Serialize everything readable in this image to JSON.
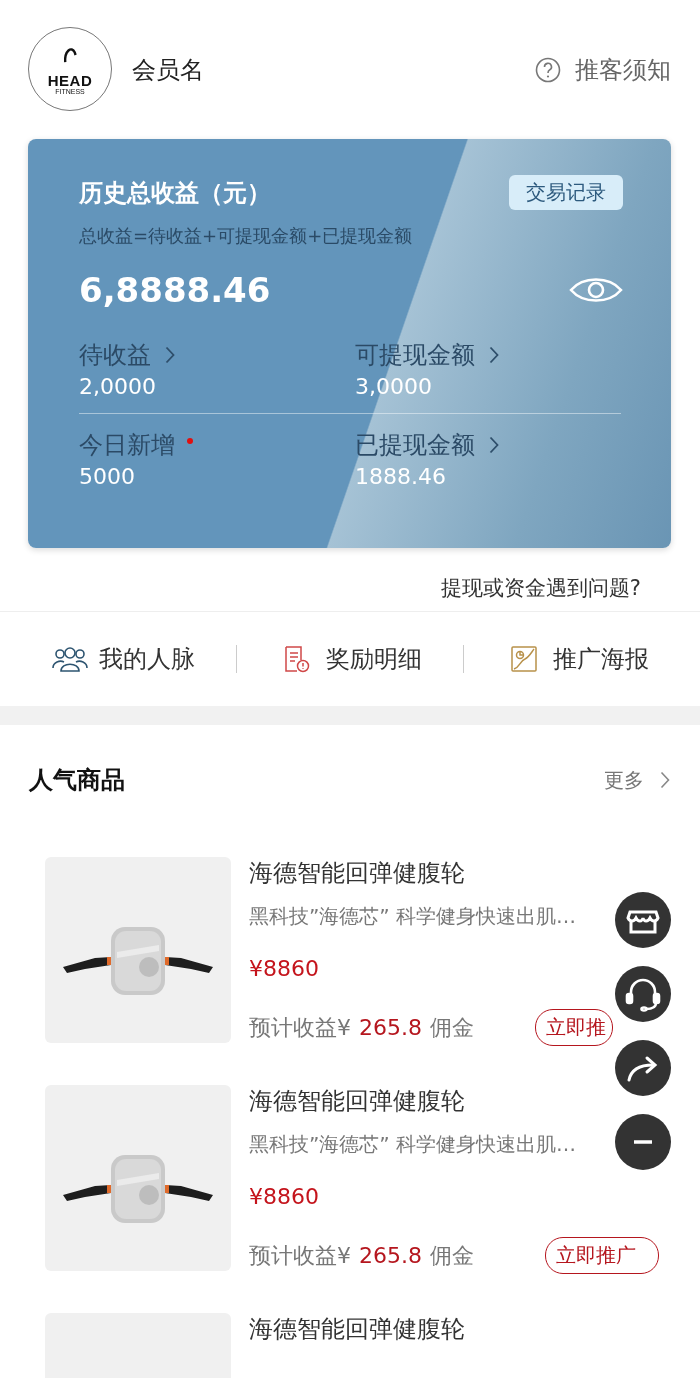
{
  "header": {
    "logo_text": "HEAD",
    "logo_subtext": "FITNESS",
    "member_name": "会员名",
    "guide": "推客须知"
  },
  "earnings_card": {
    "title": "历史总收益（元）",
    "records_button": "交易记录",
    "formula": "总收益=待收益+可提现金额+已提现金额",
    "total": "6,8888.46",
    "stats": [
      {
        "label": "待收益",
        "value": "2,0000",
        "arrow": true,
        "dot": false
      },
      {
        "label": "可提现金额",
        "value": "3,0000",
        "arrow": true,
        "dot": false
      },
      {
        "label": "今日新增",
        "value": "5000",
        "arrow": false,
        "dot": true
      },
      {
        "label": "已提现金额",
        "value": "1888.46",
        "arrow": true,
        "dot": false
      }
    ]
  },
  "help_link": "提现或资金遇到问题?",
  "shortcuts": [
    {
      "label": "我的人脉",
      "kind": "people"
    },
    {
      "label": "奖励明细",
      "kind": "report"
    },
    {
      "label": "推广海报",
      "kind": "poster"
    }
  ],
  "section": {
    "title": "人气商品",
    "more": "更多"
  },
  "products": [
    {
      "title": "海德智能回弹健腹轮",
      "description": "黑科技”海德芯” 科学健身快速出肌…",
      "price": "¥8860",
      "earnings_label": "预计收益¥",
      "earnings": "265.8",
      "commission": "佣金",
      "button": "立即推"
    },
    {
      "title": "海德智能回弹健腹轮",
      "description": "黑科技”海德芯” 科学健身快速出肌…",
      "price": "¥8860",
      "earnings_label": "预计收益¥",
      "earnings": "265.8",
      "commission": "佣金",
      "button": "立即推广"
    },
    {
      "title": "海德智能回弹健腹轮"
    }
  ]
}
